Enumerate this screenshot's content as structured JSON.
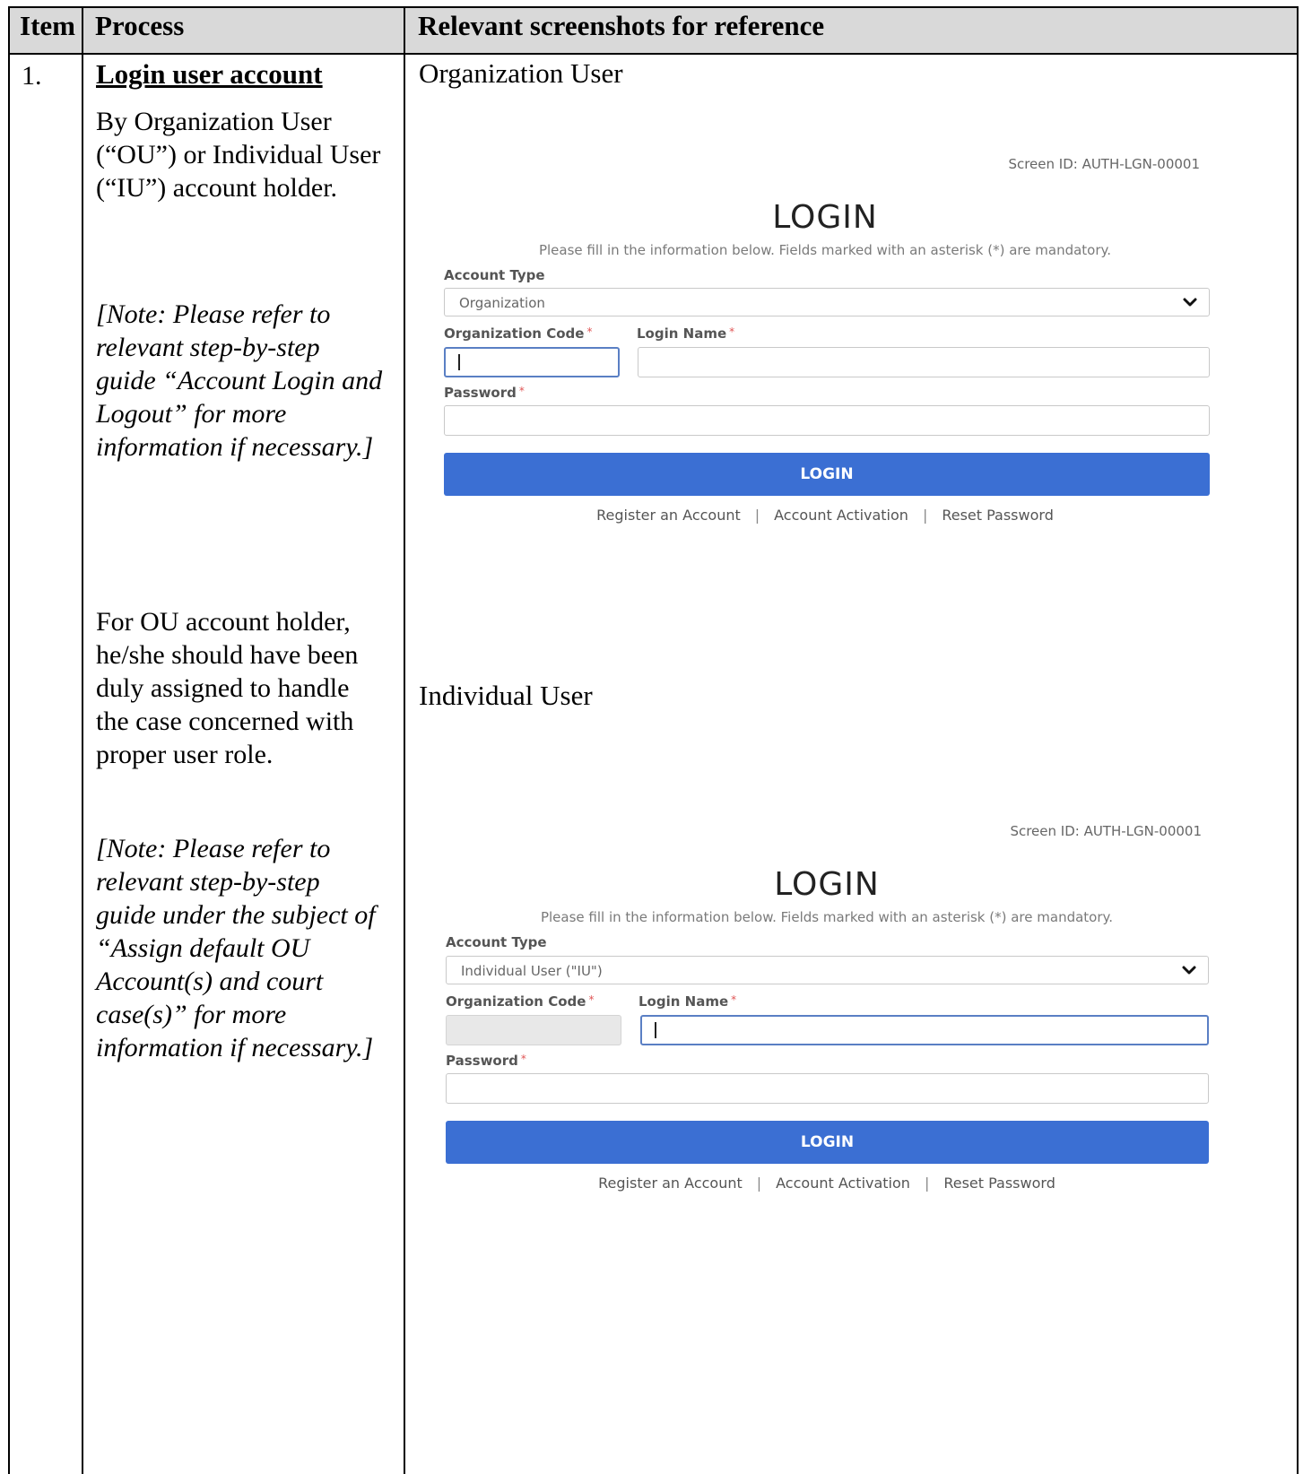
{
  "table": {
    "headers": [
      "Item",
      "Process",
      "Relevant screenshots for reference"
    ],
    "row": {
      "item": "1.",
      "process_title": "Login user account",
      "process_p1": "By Organization User (“OU”) or Individual User (“IU”) account holder.",
      "process_note1": "[Note: Please refer to relevant step-by-step guide “Account Login and Logout” for more information if necessary.]",
      "process_p2": "For OU account holder, he/she should have been duly assigned to handle the case concerned with proper user role.",
      "process_note2": "[Note: Please refer to relevant step-by-step guide under the subject of “Assign default OU Account(s) and court case(s)” for more information if necessary.]",
      "ref_heading_org": "Organization User",
      "ref_heading_ind": "Individual User"
    }
  },
  "login_org": {
    "screen_id": "Screen ID: AUTH-LGN-00001",
    "title": "LOGIN",
    "subtitle": "Please fill in the information below. Fields marked with an asterisk (*) are mandatory.",
    "account_type_label": "Account Type",
    "account_type_value": "Organization",
    "org_code_label": "Organization Code",
    "login_name_label": "Login Name",
    "password_label": "Password",
    "required_mark": "*",
    "login_button": "LOGIN",
    "link_register": "Register an Account",
    "link_activation": "Account Activation",
    "link_reset": "Reset Password",
    "separator": "|"
  },
  "login_ind": {
    "screen_id": "Screen ID: AUTH-LGN-00001",
    "title": "LOGIN",
    "subtitle": "Please fill in the information below. Fields marked with an asterisk (*) are mandatory.",
    "account_type_label": "Account Type",
    "account_type_value": "Individual User (\"IU\")",
    "org_code_label": "Organization Code",
    "login_name_label": "Login Name",
    "password_label": "Password",
    "required_mark": "*",
    "login_button": "LOGIN",
    "link_register": "Register an Account",
    "link_activation": "Account Activation",
    "link_reset": "Reset Password",
    "separator": "|"
  },
  "colors": {
    "header_bg": "#d9d9d9",
    "button_blue": "#3b6fd3",
    "required_red": "#e05555",
    "focus_border": "#5a7fc4"
  }
}
